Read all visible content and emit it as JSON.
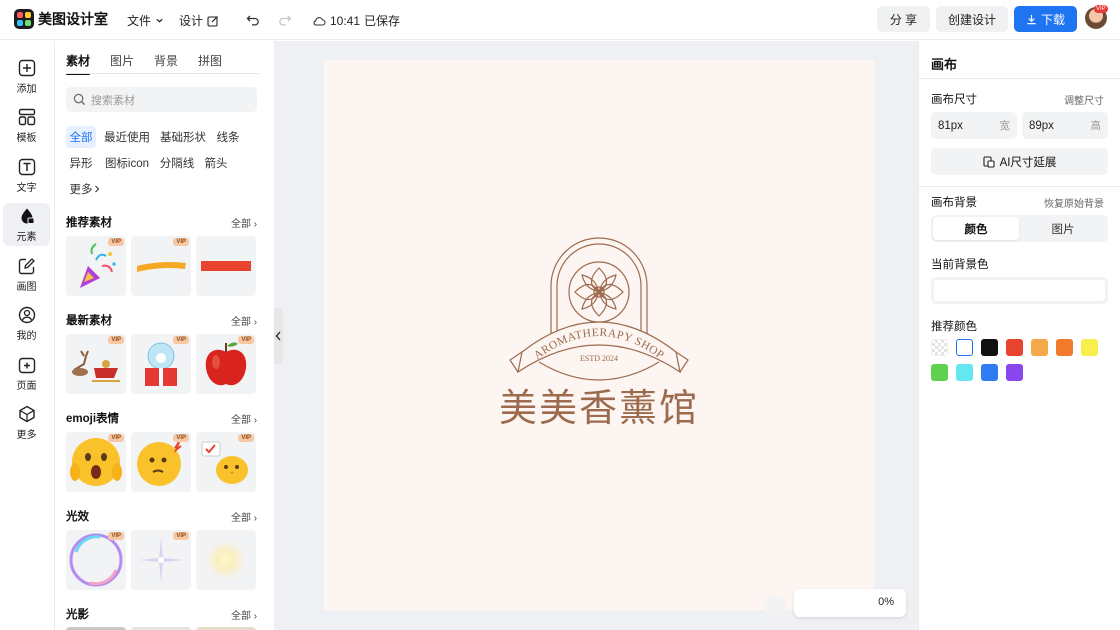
{
  "app": {
    "name": "美图设计室"
  },
  "topbar": {
    "file_menu": "文件",
    "design_menu": "设计",
    "save_time": "10:41",
    "save_status": "已保存",
    "share_label": "分 享",
    "create_label": "创建设计",
    "download_label": "下载",
    "vip_badge": "VIP"
  },
  "sidebar": {
    "items": [
      {
        "label": "添加",
        "icon": "add-icon"
      },
      {
        "label": "模板",
        "icon": "template-icon"
      },
      {
        "label": "文字",
        "icon": "text-icon"
      },
      {
        "label": "元素",
        "icon": "element-icon"
      },
      {
        "label": "画图",
        "icon": "draw-icon"
      },
      {
        "label": "我的",
        "icon": "user-icon"
      },
      {
        "label": "页面",
        "icon": "page-icon"
      },
      {
        "label": "更多",
        "icon": "more-icon"
      }
    ],
    "active_index": 3
  },
  "panel": {
    "tabs": [
      "素材",
      "图片",
      "背景",
      "拼图"
    ],
    "search_placeholder": "搜索素材",
    "chips": [
      "全部",
      "最近使用",
      "基础形状",
      "线条",
      "异形",
      "图标icon",
      "分隔线",
      "箭头",
      "更多"
    ],
    "vip_label": "VIP",
    "sections": [
      {
        "title": "推荐素材",
        "all": "全部"
      },
      {
        "title": "最新素材",
        "all": "全部"
      },
      {
        "title": "emoji表情",
        "all": "全部"
      },
      {
        "title": "光效",
        "all": "全部"
      },
      {
        "title": "光影",
        "all": "全部"
      }
    ]
  },
  "canvas": {
    "background": "#fdf5f2",
    "logo_banner_text": "AROMATHERAPY SHOP",
    "logo_est_text": "ESTD 2024",
    "brand_title": "美美香薰馆",
    "brand_color": "#9c6b4e",
    "zoom_text": "0%"
  },
  "right_panel": {
    "title": "画布",
    "size_label": "画布尺寸",
    "adjust_size": "调整尺寸",
    "width_value": "81px",
    "width_unit": "宽",
    "height_value": "89px",
    "height_unit": "高",
    "ai_extend_label": "AI尺寸延展",
    "bg_label": "画布背景",
    "restore_bg": "恢复原始背景",
    "seg_color": "颜色",
    "seg_image": "图片",
    "current_bg_label": "当前背景色",
    "recommended_label": "推荐颜色",
    "swatches": [
      "transparent",
      "#ffffff",
      "#111111",
      "#e8432e",
      "#f4a94b",
      "#f07b2c",
      "#f8ef4c",
      "#5fd14f",
      "#63e8f1",
      "#2f7cf2",
      "#8a46ee"
    ]
  },
  "colors": {
    "accent": "#1f74f2",
    "active_chip_bg": "#e6f0fe"
  }
}
